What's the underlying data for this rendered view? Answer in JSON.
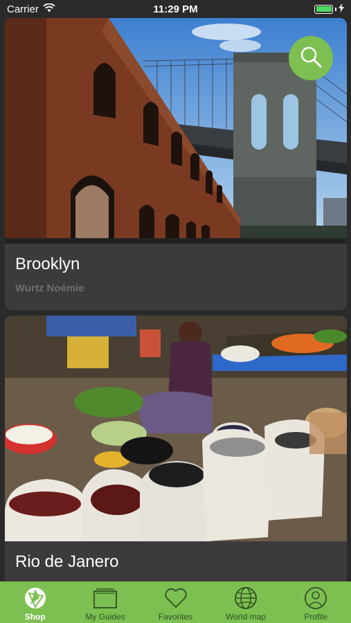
{
  "status_bar": {
    "carrier": "Carrier",
    "time": "11:29 PM",
    "battery_level": 1.0
  },
  "search_button": {
    "icon": "search-icon"
  },
  "guides": [
    {
      "title": "Brooklyn",
      "author": "Wurtz Noémie"
    },
    {
      "title": "Rio de Janero",
      "author": ""
    }
  ],
  "tab_bar": {
    "tabs": [
      {
        "label": "Shop",
        "icon": "shop-icon",
        "active": true
      },
      {
        "label": "My Guides",
        "icon": "guides-icon",
        "active": false
      },
      {
        "label": "Favorites",
        "icon": "heart-icon",
        "active": false
      },
      {
        "label": "World map",
        "icon": "globe-icon",
        "active": false
      },
      {
        "label": "Profile",
        "icon": "profile-icon",
        "active": false
      }
    ]
  },
  "colors": {
    "accent": "#7dc051",
    "background": "#2a2a2a",
    "card": "#3b3b3b"
  }
}
